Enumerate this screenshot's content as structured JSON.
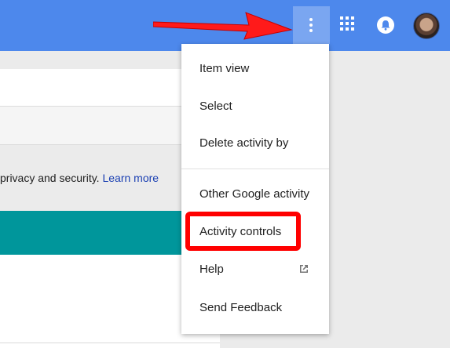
{
  "colors": {
    "topbar": "#4d88ec",
    "teal": "#00969b",
    "highlight": "#ff0000",
    "link": "#1a3fb2"
  },
  "body": {
    "privacy_text": "privacy and security.",
    "learn_more": "Learn more"
  },
  "menu": {
    "items": [
      {
        "label": "Item view"
      },
      {
        "label": "Select"
      },
      {
        "label": "Delete activity by"
      },
      {
        "label": "Other Google activity"
      },
      {
        "label": "Activity controls"
      },
      {
        "label": "Help",
        "icon": "external-link-icon"
      },
      {
        "label": "Send Feedback"
      }
    ]
  },
  "icons": [
    "more-vert-icon",
    "apps-grid-icon",
    "notifications-icon",
    "avatar",
    "red-arrow-annotation"
  ]
}
